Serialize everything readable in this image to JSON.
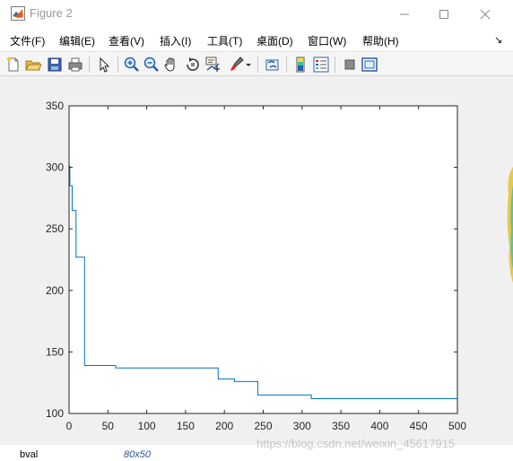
{
  "window": {
    "title": "Figure 2"
  },
  "menu": {
    "items": [
      {
        "label": "文件(F)"
      },
      {
        "label": "编辑(E)"
      },
      {
        "label": "查看(V)"
      },
      {
        "label": "插入(I)"
      },
      {
        "label": "工具(T)"
      },
      {
        "label": "桌面(D)"
      },
      {
        "label": "窗口(W)"
      },
      {
        "label": "帮助(H)"
      }
    ]
  },
  "toolbar": {
    "buttons": [
      "new-figure-icon",
      "open-file-icon",
      "save-icon",
      "print-icon",
      "select-pointer-icon",
      "zoom-in-icon",
      "zoom-out-icon",
      "pan-hand-icon",
      "rotate-3d-icon",
      "data-cursor-icon",
      "brush-icon",
      "dropdown-arrow-icon",
      "link-plot-icon",
      "colorbar-icon",
      "legend-icon",
      "hide-plot-tools-icon",
      "show-plot-tools-icon"
    ]
  },
  "chart_data": {
    "type": "line",
    "title": "",
    "xlabel": "",
    "ylabel": "",
    "xlim": [
      0,
      500
    ],
    "ylim": [
      100,
      350
    ],
    "xticks": [
      0,
      50,
      100,
      150,
      200,
      250,
      300,
      350,
      400,
      450,
      500
    ],
    "yticks": [
      100,
      150,
      200,
      250,
      300,
      350
    ],
    "grid": false,
    "line_color": "#0072BD",
    "series": [
      {
        "x": [
          0,
          1,
          1,
          4,
          4,
          9,
          9,
          20,
          20,
          60,
          60,
          192,
          192,
          213,
          213,
          243,
          243,
          312,
          312,
          500
        ],
        "y": [
          301,
          301,
          285,
          285,
          265,
          265,
          227,
          227,
          139,
          139,
          137,
          137,
          128,
          128,
          126,
          126,
          115,
          115,
          112,
          112
        ]
      }
    ]
  },
  "background": {
    "var_name": "bval",
    "var_size": "80x50",
    "watermark": "https://blog.csdn.net/weixin_45617915"
  }
}
